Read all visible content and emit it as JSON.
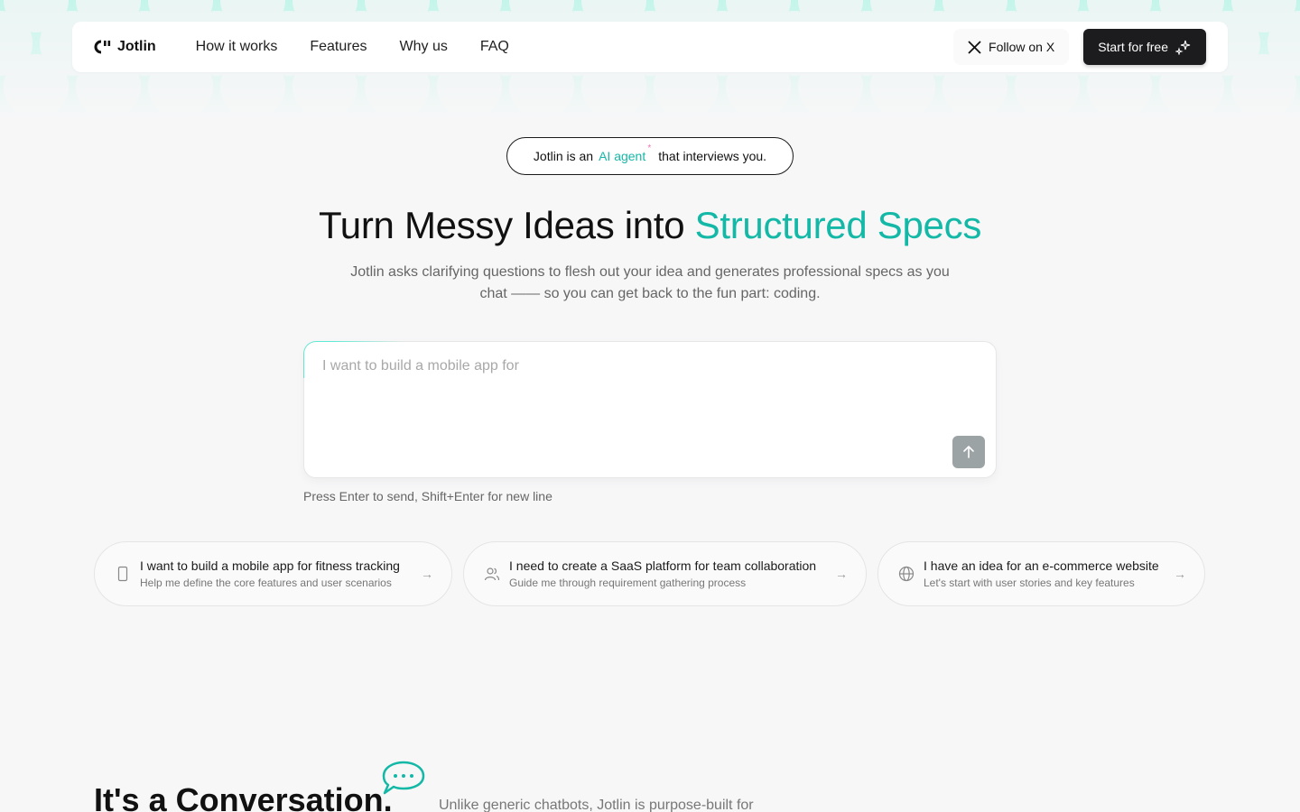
{
  "brand": {
    "name": "Jotlin"
  },
  "nav": {
    "links": [
      "How it works",
      "Features",
      "Why us",
      "FAQ"
    ],
    "follow_label": "Follow on X",
    "start_label": "Start for free"
  },
  "hero": {
    "pill_prefix": "Jotlin is an",
    "pill_accent": "AI agent",
    "pill_star": "*",
    "pill_suffix": "that interviews you.",
    "title_main": "Turn Messy Ideas into ",
    "title_accent": "Structured Specs",
    "subtitle": "Jotlin asks clarifying questions to flesh out your idea and generates professional specs as you chat —— so you can get back to the fun part: coding."
  },
  "composer": {
    "placeholder": "I want to build a mobile app for",
    "hint": "Press Enter to send, Shift+Enter for new line"
  },
  "suggestions": [
    {
      "title": "I want to build a mobile app for fitness tracking",
      "desc": "Help me define the core features and user scenarios",
      "icon": "mobile-phone-icon"
    },
    {
      "title": "I need to create a SaaS platform for team collaboration",
      "desc": "Guide me through requirement gathering process",
      "icon": "users-icon"
    },
    {
      "title": "I have an idea for an e-commerce website",
      "desc": "Let's start with user stories and key features",
      "icon": "globe-icon"
    }
  ],
  "section": {
    "title": "It's a Conversation.",
    "desc": "Unlike generic chatbots, Jotlin is purpose-built for"
  },
  "colors": {
    "accent": "#14b8a6",
    "dark": "#1c1c1e",
    "pattern": "#ccf7ee"
  }
}
